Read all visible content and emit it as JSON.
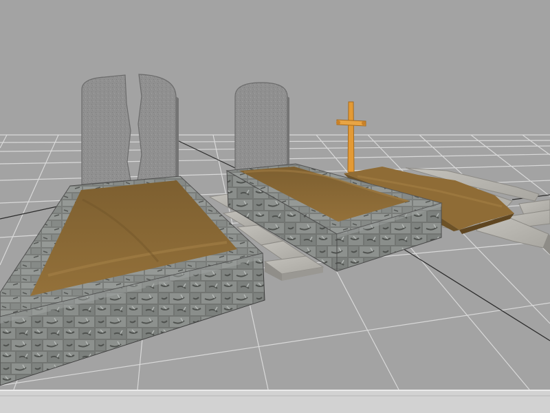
{
  "scene": {
    "background_color": "#a3a3a3",
    "grid_color": "#d8d8d8",
    "dirt_color": "#8a6a35",
    "headstone_color": "#8e8e8e",
    "stone_border_color": "#6e6e6e",
    "paving_color": "#b9b7b1",
    "cross_color": "#e39a35",
    "objects": [
      "split-headstone",
      "large-grave-stone-border",
      "round-headstone",
      "medium-grave-stone-border",
      "wooden-cross",
      "dirt-mound-grave",
      "stone-paving-slabs"
    ]
  },
  "status_bar": {
    "color": "#d2d2d2"
  }
}
